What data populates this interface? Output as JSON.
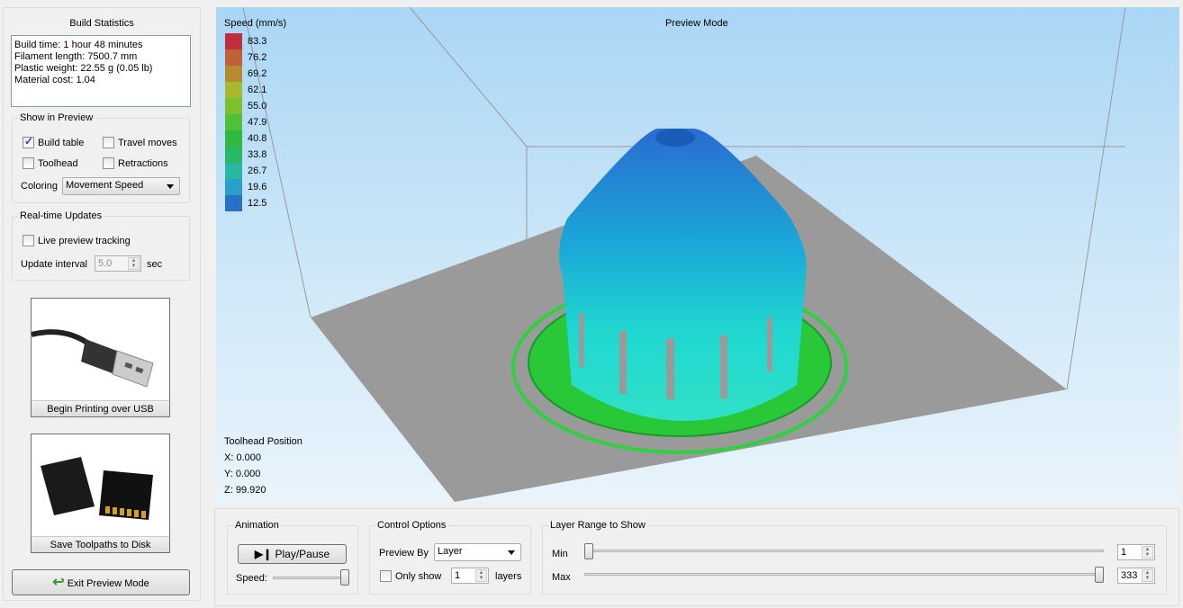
{
  "build_stats": {
    "title": "Build Statistics",
    "lines": [
      "Build time: 1 hour 48 minutes",
      "Filament length: 7500.7 mm",
      "Plastic weight: 22.55 g (0.05 lb)",
      "Material cost: 1.04"
    ]
  },
  "show_in_preview": {
    "title": "Show in Preview",
    "build_table": "Build table",
    "build_table_checked": true,
    "travel_moves": "Travel moves",
    "travel_moves_checked": false,
    "toolhead": "Toolhead",
    "toolhead_checked": false,
    "retractions": "Retractions",
    "retractions_checked": false,
    "coloring_label": "Coloring",
    "coloring_value": "Movement Speed"
  },
  "realtime": {
    "title": "Real-time Updates",
    "live_tracking": "Live preview tracking",
    "live_tracking_checked": false,
    "interval_label": "Update interval",
    "interval_value": "5.0",
    "interval_unit": "sec"
  },
  "buttons": {
    "usb": "Begin Printing over USB",
    "usb_icon": "usb-cable-icon",
    "disk": "Save Toolpaths to Disk",
    "disk_icon": "sd-card-icon",
    "exit": "Exit Preview Mode",
    "exit_icon": "back-arrow-icon"
  },
  "viewport": {
    "mode": "Preview Mode",
    "legend_title": "Speed (mm/s)",
    "legend": [
      {
        "v": "83.3",
        "c": "#c0303a"
      },
      {
        "v": "76.2",
        "c": "#c0603a"
      },
      {
        "v": "69.2",
        "c": "#b88a30"
      },
      {
        "v": "62.1",
        "c": "#a8b830"
      },
      {
        "v": "55.0",
        "c": "#7cc030"
      },
      {
        "v": "47.9",
        "c": "#50c038"
      },
      {
        "v": "40.8",
        "c": "#30b840"
      },
      {
        "v": "33.8",
        "c": "#28b868"
      },
      {
        "v": "26.7",
        "c": "#28b8a0"
      },
      {
        "v": "19.6",
        "c": "#28a0c8"
      },
      {
        "v": "12.5",
        "c": "#2870c8"
      }
    ],
    "toolhead_title": "Toolhead Position",
    "x": "X: 0.000",
    "y": "Y: 0.000",
    "z": "Z: 99.920"
  },
  "animation": {
    "title": "Animation",
    "play": "Play/Pause",
    "speed_label": "Speed:",
    "speed_value": 1.0
  },
  "control": {
    "title": "Control Options",
    "preview_by_label": "Preview By",
    "preview_by_value": "Layer",
    "only_show": "Only show",
    "only_show_checked": false,
    "only_show_value": "1",
    "layers": "layers"
  },
  "layer_range": {
    "title": "Layer Range to Show",
    "min_label": "Min",
    "min_value": "1",
    "max_label": "Max",
    "max_value": "333",
    "total_layers": 333
  }
}
